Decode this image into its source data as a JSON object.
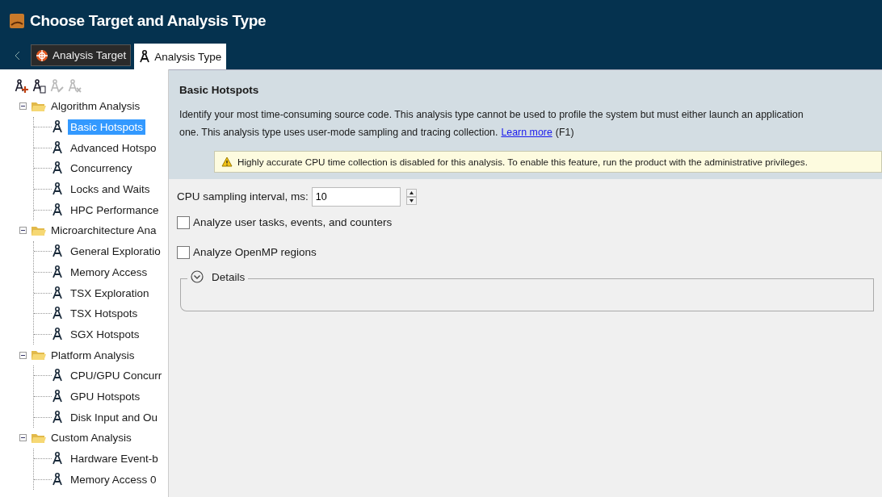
{
  "window": {
    "title": "Choose Target and Analysis Type"
  },
  "tabs": [
    {
      "label": "Analysis Target",
      "selected": false,
      "kind": "target"
    },
    {
      "label": "Analysis Type",
      "selected": true,
      "kind": "type"
    }
  ],
  "toolbar": [
    {
      "kind": "add",
      "disabled": false
    },
    {
      "kind": "copy",
      "disabled": false
    },
    {
      "kind": "edit",
      "disabled": true
    },
    {
      "kind": "delete",
      "disabled": true
    }
  ],
  "tree": [
    {
      "label": "Algorithm Analysis",
      "expanded": true,
      "children": [
        {
          "label": "Basic Hotspots",
          "selected": true
        },
        {
          "label": "Advanced Hotspo",
          "selected": false
        },
        {
          "label": "Concurrency",
          "selected": false
        },
        {
          "label": "Locks and Waits",
          "selected": false
        },
        {
          "label": "HPC Performance",
          "selected": false
        }
      ]
    },
    {
      "label": "Microarchitecture Ana",
      "expanded": true,
      "children": [
        {
          "label": "General Exploratio",
          "selected": false
        },
        {
          "label": "Memory Access",
          "selected": false
        },
        {
          "label": "TSX Exploration",
          "selected": false
        },
        {
          "label": "TSX Hotspots",
          "selected": false
        },
        {
          "label": "SGX Hotspots",
          "selected": false
        }
      ]
    },
    {
      "label": "Platform Analysis",
      "expanded": true,
      "children": [
        {
          "label": "CPU/GPU Concurr",
          "selected": false
        },
        {
          "label": "GPU Hotspots",
          "selected": false
        },
        {
          "label": "Disk Input and Ou",
          "selected": false
        }
      ]
    },
    {
      "label": "Custom Analysis",
      "expanded": true,
      "children": [
        {
          "label": "Hardware Event-b",
          "selected": false
        },
        {
          "label": "Memory Access 0",
          "selected": false
        }
      ]
    }
  ],
  "details": {
    "heading": "Basic Hotspots",
    "description_1": "Identify your most time-consuming source code. This analysis type cannot be used to profile the system but must either launch an application",
    "description_2": "one. This analysis type uses user-mode sampling and tracing collection.",
    "link": "Learn more",
    "shortcut": "(F1)",
    "warning": "Highly accurate CPU time collection is disabled for this analysis. To enable this feature, run the product with the administrative privileges."
  },
  "options": [
    {
      "kind": "spinner",
      "label": "CPU sampling interval, ms:",
      "value": "10"
    },
    {
      "kind": "checkbox",
      "label": "Analyze user tasks, events, and counters",
      "checked": false
    },
    {
      "kind": "checkbox",
      "label": "Analyze OpenMP regions",
      "checked": false
    }
  ],
  "details_group": {
    "label": "Details",
    "expanded": false
  }
}
